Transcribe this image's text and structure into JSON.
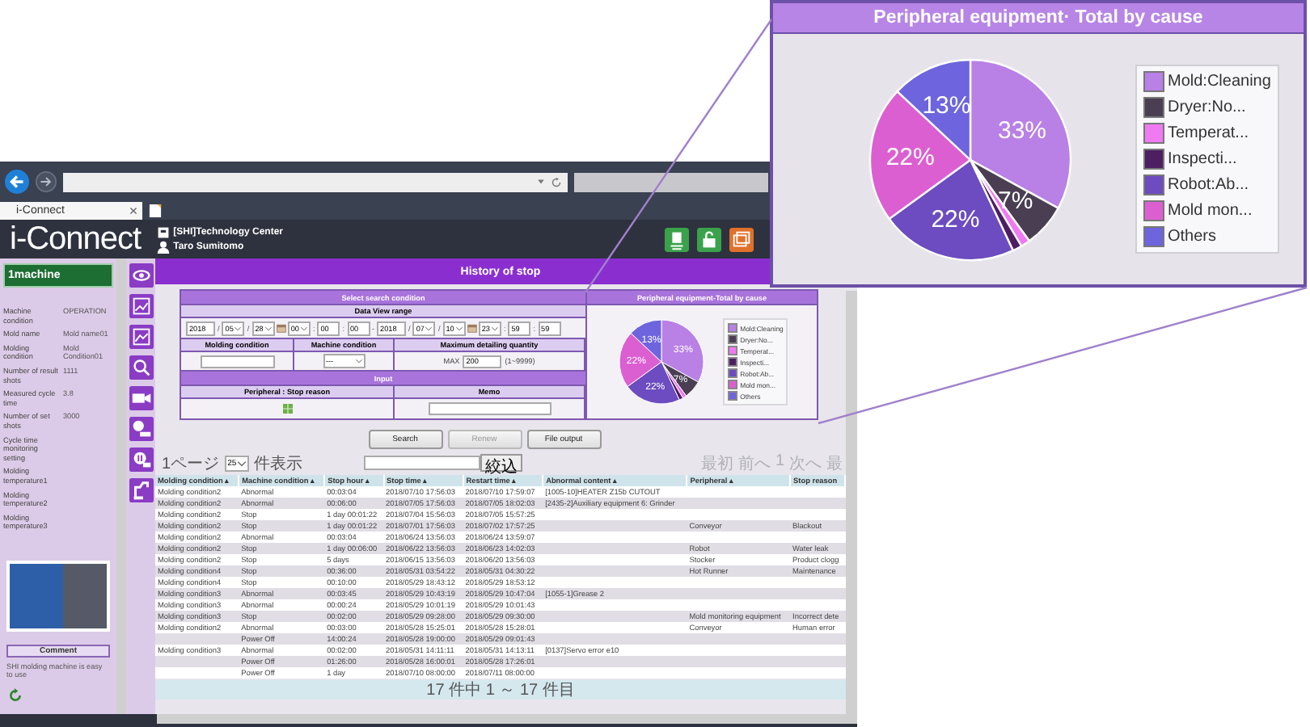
{
  "callout": {
    "title": "Peripheral equipment· Total by cause",
    "chart_data": {
      "type": "pie",
      "categories": [
        "Mold:Cleaning",
        "Dryer:No...",
        "Temperat...",
        "Inspecti...",
        "Robot:Ab...",
        "Mold mon...",
        "Others"
      ],
      "values": [
        33,
        7,
        1.5,
        1.5,
        22,
        22,
        13
      ],
      "colors": [
        "#b980e6",
        "#4a3f52",
        "#f07af2",
        "#4d1f62",
        "#6c4cc0",
        "#dc5fd2",
        "#6d64de"
      ],
      "value_labels": [
        "33%",
        "7%",
        null,
        null,
        "22%",
        "22%",
        "13%"
      ],
      "legend": "right"
    }
  },
  "browser": {
    "tab": {
      "title": "i-Connect"
    }
  },
  "header": {
    "logo": "i-Connect",
    "site": "[SHI]Technology Center",
    "user": "Taro Sumitomo"
  },
  "sidebar": {
    "machine": "1machine",
    "fields": [
      {
        "label": "Machine condition",
        "value": "OPERATION"
      },
      {
        "label": "Mold name",
        "value": "Mold name01"
      },
      {
        "label": "Molding condition",
        "value": "Mold Condition01"
      },
      {
        "label": "Number of result shots",
        "value": "1111"
      },
      {
        "label": "Measured cycle time",
        "value": "3.8"
      },
      {
        "label": "Number of set shots",
        "value": "3000"
      },
      {
        "label": "Cycle time monitoring setting"
      },
      {
        "label": "Molding temperature1"
      },
      {
        "label": "Molding temperature2"
      },
      {
        "label": "Molding temperature3"
      }
    ],
    "comment_button": "Comment",
    "comment": "SHI molding machine is easy to use"
  },
  "page_title": "History of stop",
  "search": {
    "title": "Select search condition",
    "range_title": "Data View range",
    "range_parts": [
      {
        "kind": "field",
        "text": "2018"
      },
      {
        "kind": "sep",
        "text": "/"
      },
      {
        "kind": "select",
        "text": "05"
      },
      {
        "kind": "sep",
        "text": "/"
      },
      {
        "kind": "select",
        "text": "28"
      },
      {
        "kind": "calendar"
      },
      {
        "kind": "select",
        "text": "00"
      },
      {
        "kind": "sep",
        "text": ":"
      },
      {
        "kind": "field",
        "text": "00"
      },
      {
        "kind": "sep",
        "text": ":"
      },
      {
        "kind": "field",
        "text": "00"
      },
      {
        "kind": "sep",
        "text": "-"
      },
      {
        "kind": "field",
        "text": "2018"
      },
      {
        "kind": "sep",
        "text": "/"
      },
      {
        "kind": "select",
        "text": "07"
      },
      {
        "kind": "sep",
        "text": "/"
      },
      {
        "kind": "select",
        "text": "10"
      },
      {
        "kind": "calendar"
      },
      {
        "kind": "select",
        "text": "23"
      },
      {
        "kind": "sep",
        "text": ":"
      },
      {
        "kind": "field",
        "text": "59"
      },
      {
        "kind": "sep",
        "text": ":"
      },
      {
        "kind": "field",
        "text": "59"
      }
    ],
    "molding_condition": {
      "label": "Molding condition"
    },
    "machine_condition": {
      "label": "Machine condition",
      "value": "---"
    },
    "max_quantity": {
      "label": "Maximum detailing quantity",
      "prefix": "MAX",
      "value": "200",
      "hint": "(1~9999)"
    },
    "input_title": "Input",
    "stop_reason": {
      "label": "Peripheral : Stop reason"
    },
    "memo": {
      "label": "Memo"
    }
  },
  "chart_panel": {
    "title": "Peripheral equipment-Total by cause",
    "chart_data": {
      "type": "pie",
      "categories": [
        "Mold:Cleaning",
        "Dryer:No...",
        "Temperat...",
        "Inspecti...",
        "Robot:Ab...",
        "Mold mon...",
        "Others"
      ],
      "values": [
        33,
        7,
        1.5,
        1.5,
        22,
        22,
        13
      ],
      "colors": [
        "#b980e6",
        "#4a3f52",
        "#f07af2",
        "#4d1f62",
        "#6c4cc0",
        "#dc5fd2",
        "#6d64de"
      ],
      "value_labels": [
        "33%",
        "7%",
        null,
        null,
        "22%",
        "22%",
        "13%"
      ],
      "legend": "right"
    }
  },
  "buttons": [
    {
      "label": "Search",
      "disabled": false
    },
    {
      "label": "Renew",
      "disabled": true
    },
    {
      "label": "File output",
      "disabled": false
    }
  ],
  "paging": {
    "prefix": "1ページ",
    "page_size": "25",
    "suffix": "件表示",
    "filter_button": "絞込",
    "pager": [
      "最初",
      "前へ",
      "1",
      "次へ",
      "最"
    ]
  },
  "table": {
    "columns": [
      "Molding condition ▴",
      "Machine condition ▴",
      "Stop hour ▴",
      "Stop time ▴",
      "Restart time ▴",
      "Abnormal content ▴",
      "Peripheral ▴",
      "Stop reason"
    ],
    "rows": [
      [
        "Molding condition2",
        "Abnormal",
        "00:03:04",
        "2018/07/10 17:56:03",
        "2018/07/10 17:59:07",
        "[1005-10]HEATER Z15b CUTOUT",
        null,
        null
      ],
      [
        "Molding condition2",
        "Abnormal",
        "00:06:00",
        "2018/07/05 17:56:03",
        "2018/07/05 18:02:03",
        "[2435-2]Auxiliary equipment 6: Grinder",
        null,
        null
      ],
      [
        "Molding condition2",
        "Stop",
        "1 day 00:01:22",
        "2018/07/04 15:56:03",
        "2018/07/05 15:57:25",
        null,
        null,
        null
      ],
      [
        "Molding condition2",
        "Stop",
        "1 day 00:01:22",
        "2018/07/01 17:56:03",
        "2018/07/02 17:57:25",
        null,
        "Conveyor",
        "Blackout"
      ],
      [
        "Molding condition2",
        "Abnormal",
        "00:03:04",
        "2018/06/24 13:56:03",
        "2018/06/24 13:59:07",
        null,
        null,
        null
      ],
      [
        "Molding condition2",
        "Stop",
        "1 day 00:06:00",
        "2018/06/22 13:56:03",
        "2018/06/23 14:02:03",
        null,
        "Robot",
        "Water leak"
      ],
      [
        "Molding condition2",
        "Stop",
        "5 days",
        "2018/06/15 13:56:03",
        "2018/06/20 13:56:03",
        null,
        "Stocker",
        "Product clogg"
      ],
      [
        "Molding condition4",
        "Stop",
        "00:36:00",
        "2018/05/31 03:54:22",
        "2018/05/31 04:30:22",
        null,
        "Hot Runner",
        "Maintenance"
      ],
      [
        "Molding condition4",
        "Stop",
        "00:10:00",
        "2018/05/29 18:43:12",
        "2018/05/29 18:53:12",
        null,
        null,
        null
      ],
      [
        "Molding condition3",
        "Abnormal",
        "00:03:45",
        "2018/05/29 10:43:19",
        "2018/05/29 10:47:04",
        "[1055-1]Grease 2",
        null,
        null
      ],
      [
        "Molding condition3",
        "Abnormal",
        "00:00:24",
        "2018/05/29 10:01:19",
        "2018/05/29 10:01:43",
        null,
        null,
        null
      ],
      [
        "Molding condition3",
        "Stop",
        "00:02:00",
        "2018/05/29 09:28:00",
        "2018/05/29 09:30:00",
        null,
        "Mold monitoring equipment",
        "Incorrect dete"
      ],
      [
        "Molding condition2",
        "Abnormal",
        "00:03:00",
        "2018/05/28 15:25:01",
        "2018/05/28 15:28:01",
        null,
        "Conveyor",
        "Human error"
      ],
      [
        null,
        "Power Off",
        "14:00:24",
        "2018/05/28 19:00:00",
        "2018/05/29 09:01:43",
        null,
        null,
        null
      ],
      [
        "Molding condition3",
        "Abnormal",
        "00:02:00",
        "2018/05/31 14:11:11",
        "2018/05/31 14:13:11",
        "[0137]Servo error e10",
        null,
        null
      ],
      [
        null,
        "Power Off",
        "01:26:00",
        "2018/05/28 16:00:01",
        "2018/05/28 17:26:01",
        null,
        null,
        null
      ],
      [
        null,
        "Power Off",
        "1 day",
        "2018/07/10 08:00:00",
        "2018/07/11 08:00:00",
        null,
        null,
        null
      ]
    ],
    "footer": "17 件中 1 ～ 17 件目"
  }
}
